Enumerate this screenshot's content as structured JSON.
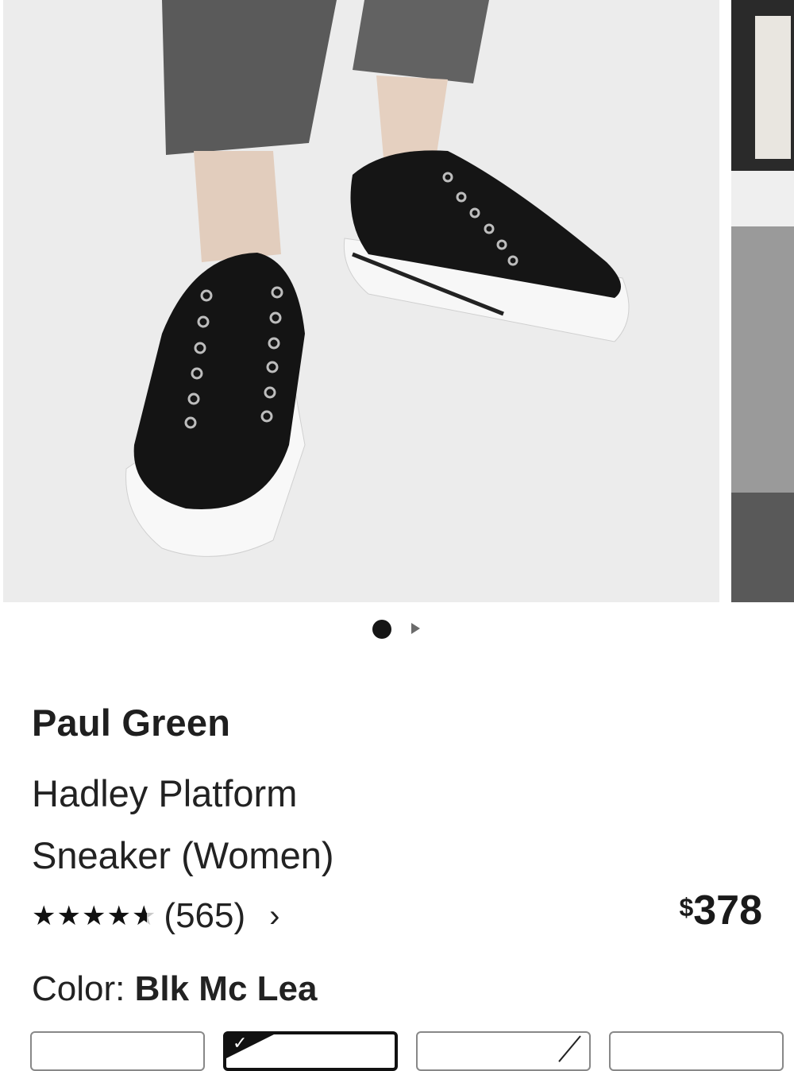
{
  "gallery": {
    "image_alt": "Black leather lace-up platform sneakers worn with cropped grey jeans",
    "dots": [
      "active",
      "next"
    ]
  },
  "product": {
    "brand": "Paul Green",
    "name_line1": "Hadley Platform",
    "name_line2": "Sneaker (Women)",
    "rating": 4.6,
    "review_count": "(565)",
    "reviews_chevron": "›",
    "price_currency": "$",
    "price_amount": "378",
    "color_label": "Color:",
    "color_value": "Blk Mc Lea"
  },
  "icons": {
    "star": "★",
    "check": "✓"
  },
  "colors": {
    "text": "#1a1a1a",
    "star": "#111111",
    "star_empty": "#c9c9c9",
    "swatch_border": "#888888",
    "swatch_selected": "#111111"
  }
}
